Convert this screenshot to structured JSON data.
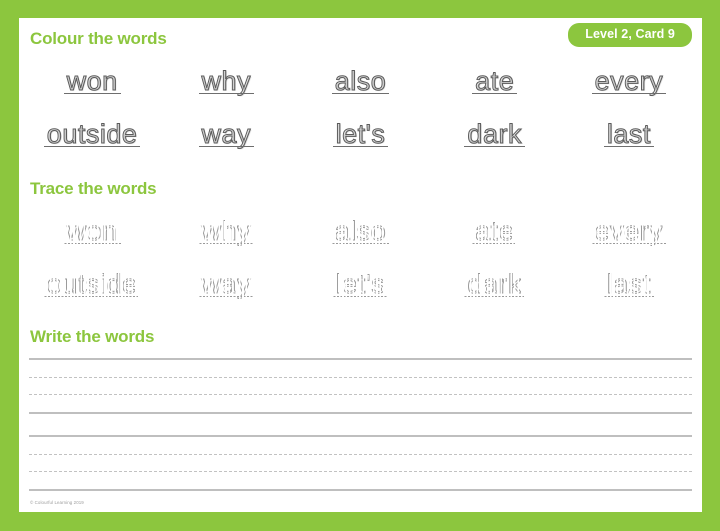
{
  "worksheet": {
    "badge_label": "Level 2, Card 9",
    "footer_credit": "© Colourful Learning 2019",
    "accent_color": "#8cc63e",
    "border_color": "#8cc63e",
    "card_color": "#ffffff",
    "outline_stroke_color": "#5b5b5b",
    "dotted_stroke_color": "#9a9a9a",
    "rule_color": "#bfbfbf"
  },
  "sections": {
    "colour": {
      "heading": "Colour the words",
      "style": "outline",
      "rows": [
        [
          "won",
          "why",
          "also",
          "ate",
          "every"
        ],
        [
          "outside",
          "way",
          "let's",
          "dark",
          "last"
        ]
      ]
    },
    "trace": {
      "heading": "Trace the words",
      "style": "dotted",
      "rows": [
        [
          "won",
          "why",
          "also",
          "ate",
          "every"
        ],
        [
          "outside",
          "way",
          "let's",
          "dark",
          "last"
        ]
      ]
    },
    "write": {
      "heading": "Write the words",
      "bands": 2,
      "lines_per_band": [
        "solid",
        "dashed",
        "dashed",
        "solid"
      ]
    }
  }
}
